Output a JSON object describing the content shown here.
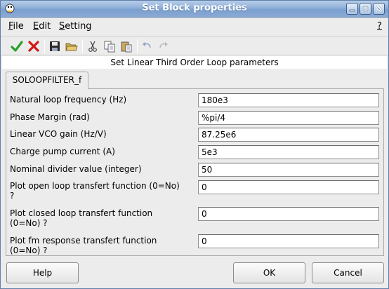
{
  "window": {
    "title": "Set Block properties"
  },
  "colors": {
    "titlebar": "#8fb0d9",
    "check_green": "#2aa02a",
    "cross_red": "#d01818"
  },
  "menu": [
    {
      "label": "File",
      "accel": "F"
    },
    {
      "label": "Edit",
      "accel": "E"
    },
    {
      "label": "Setting",
      "accel": "S"
    }
  ],
  "menu_help": "?",
  "toolbar_icons": [
    "check-icon",
    "cross-icon",
    "save-icon",
    "open-folder-icon",
    "cut-icon",
    "copy-icon",
    "paste-icon",
    "undo-icon",
    "redo-icon"
  ],
  "heading": "Set Linear Third Order Loop parameters",
  "tab": {
    "label": "SOLOOPFILTER_f"
  },
  "parameters": [
    {
      "label": "Natural loop frequency (Hz)",
      "value": "180e3"
    },
    {
      "label": "Phase Margin (rad)",
      "value": "%pi/4"
    },
    {
      "label": "Linear VCO gain (Hz/V)",
      "value": "87.25e6"
    },
    {
      "label": "Charge pump current (A)",
      "value": "5e3"
    },
    {
      "label": "Nominal divider value (integer)",
      "value": "50"
    },
    {
      "label_line1": "Plot open loop transfert function (0=No)",
      "label_line2": "?",
      "value": "0"
    },
    {
      "label_line1": "Plot closed loop transfert function",
      "label_line2": "(0=No) ?",
      "value": "0"
    },
    {
      "label_line1": "Plot fm response transfert function",
      "label_line2": "(0=No) ?",
      "value": "0"
    }
  ],
  "buttons": {
    "help": "Help",
    "ok": "OK",
    "cancel": "Cancel"
  }
}
